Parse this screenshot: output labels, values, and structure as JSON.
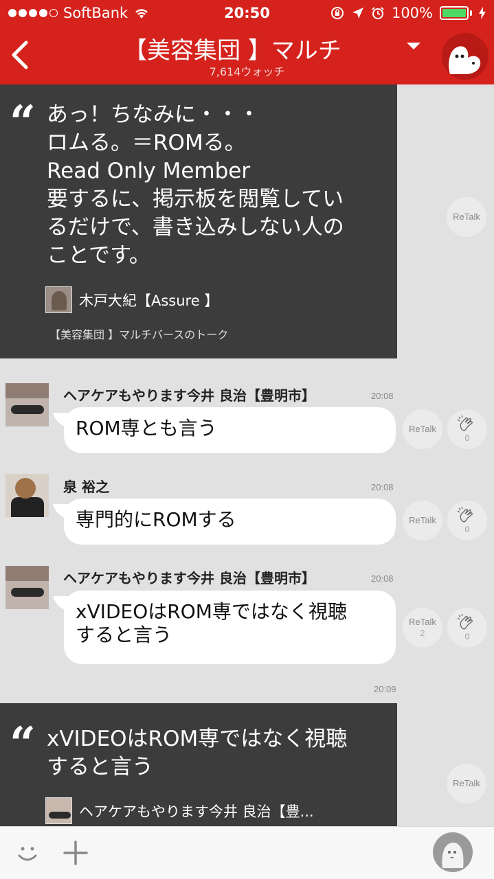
{
  "status_bar": {
    "carrier": "SoftBank",
    "time": "20:50",
    "battery": "100%",
    "signal_bars_filled": 4,
    "signal_bars_total": 5
  },
  "header": {
    "title": "【美容集団 】マルチ",
    "watch_count": "7,614ウォッチ",
    "back_icon": "chevron-left-icon",
    "dropdown_icon": "triangle-down-icon",
    "avatar_icon": "ghost-mascot-icon"
  },
  "colors": {
    "header_bg": "#d5221c",
    "quote_bg": "#3c3c3c",
    "chat_bg": "#e1e1e1",
    "bubble_bg": "#ffffff",
    "battery_fill": "#4cd964"
  },
  "quote1": {
    "lines": [
      "あっ！ちなみに・・・",
      "ロムる。＝ROMる。",
      "Read Only Member",
      "要するに、掲示板を閲覧してい",
      "るだけで、書き込みしない人の",
      "ことです。"
    ],
    "author": "木戸大紀【Assure 】",
    "source": "【美容集団 】マルチバースのトーク",
    "retalk": "ReTalk"
  },
  "messages": [
    {
      "name": "ヘアケアもやります今井 良治【豊明市】",
      "time": "20:08",
      "lines": [
        "ROM専とも言う"
      ],
      "retalk": "ReTalk",
      "retalk_count": "",
      "clap_count": "0"
    },
    {
      "name": "泉 裕之",
      "time": "20:08",
      "lines": [
        "専門的にROMする"
      ],
      "retalk": "ReTalk",
      "retalk_count": "",
      "clap_count": "0"
    },
    {
      "name": "ヘアケアもやります今井 良治【豊明市】",
      "time": "20:08",
      "lines": [
        "xVIDEOはROM専ではなく視聴",
        "すると言う"
      ],
      "retalk": "ReTalk",
      "retalk_count": "2",
      "clap_count": "0"
    }
  ],
  "retalk_time": "20:09",
  "quote2": {
    "lines": [
      "xVIDEOはROM専ではなく視聴",
      "すると言う"
    ],
    "author": "ヘアケアもやります今井 良治【豊...",
    "retalk": "ReTalk"
  },
  "bottom_bar": {
    "emoji_icon": "smiley-icon",
    "add_icon": "plus-icon",
    "profile_icon": "user-avatar-icon"
  }
}
